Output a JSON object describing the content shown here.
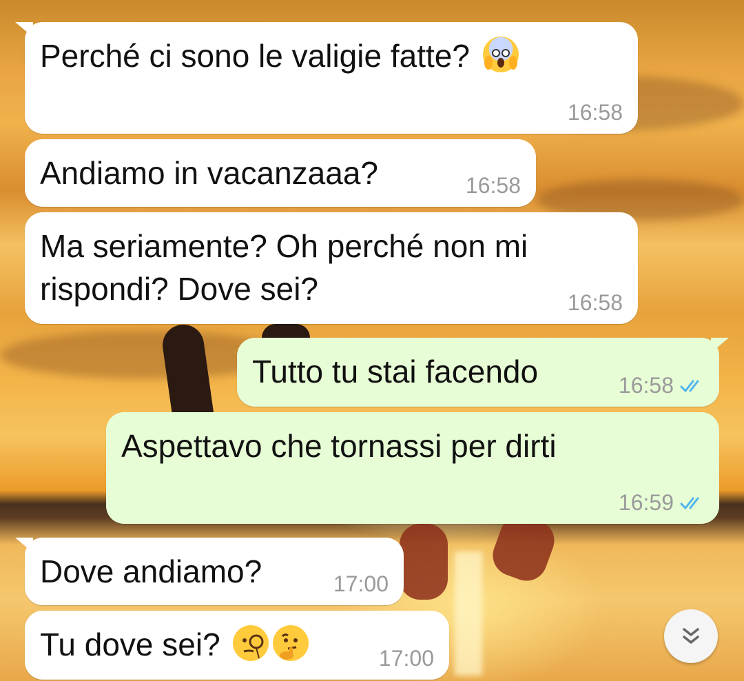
{
  "messages": [
    {
      "direction": "in",
      "text": "Perché ci sono le valigie fatte?",
      "emojis": [
        "face-screaming-in-fear"
      ],
      "time": "16:58"
    },
    {
      "direction": "in",
      "text": "Andiamo in vacanzaaa?",
      "time": "16:58"
    },
    {
      "direction": "in",
      "text": "Ma seriamente? Oh perché non mi rispondi? Dove sei?",
      "time": "16:58"
    },
    {
      "direction": "out",
      "text": "Tutto tu stai facendo",
      "time": "16:58",
      "status": "read"
    },
    {
      "direction": "out",
      "text": "Aspettavo che tornassi per dirti",
      "time": "16:59",
      "status": "read"
    },
    {
      "direction": "in",
      "text": "Dove andiamo?",
      "time": "17:00"
    },
    {
      "direction": "in",
      "text": "Tu dove sei?",
      "emojis": [
        "face-with-monocle",
        "thinking-face"
      ],
      "time": "17:00"
    }
  ],
  "scroll_button": {
    "icon": "double-chevron-down-icon"
  },
  "colors": {
    "incoming_bubble": "#ffffff",
    "outgoing_bubble": "#e7fdd6",
    "read_ticks": "#4fb6ec",
    "timestamp": "#9a9a9a"
  }
}
